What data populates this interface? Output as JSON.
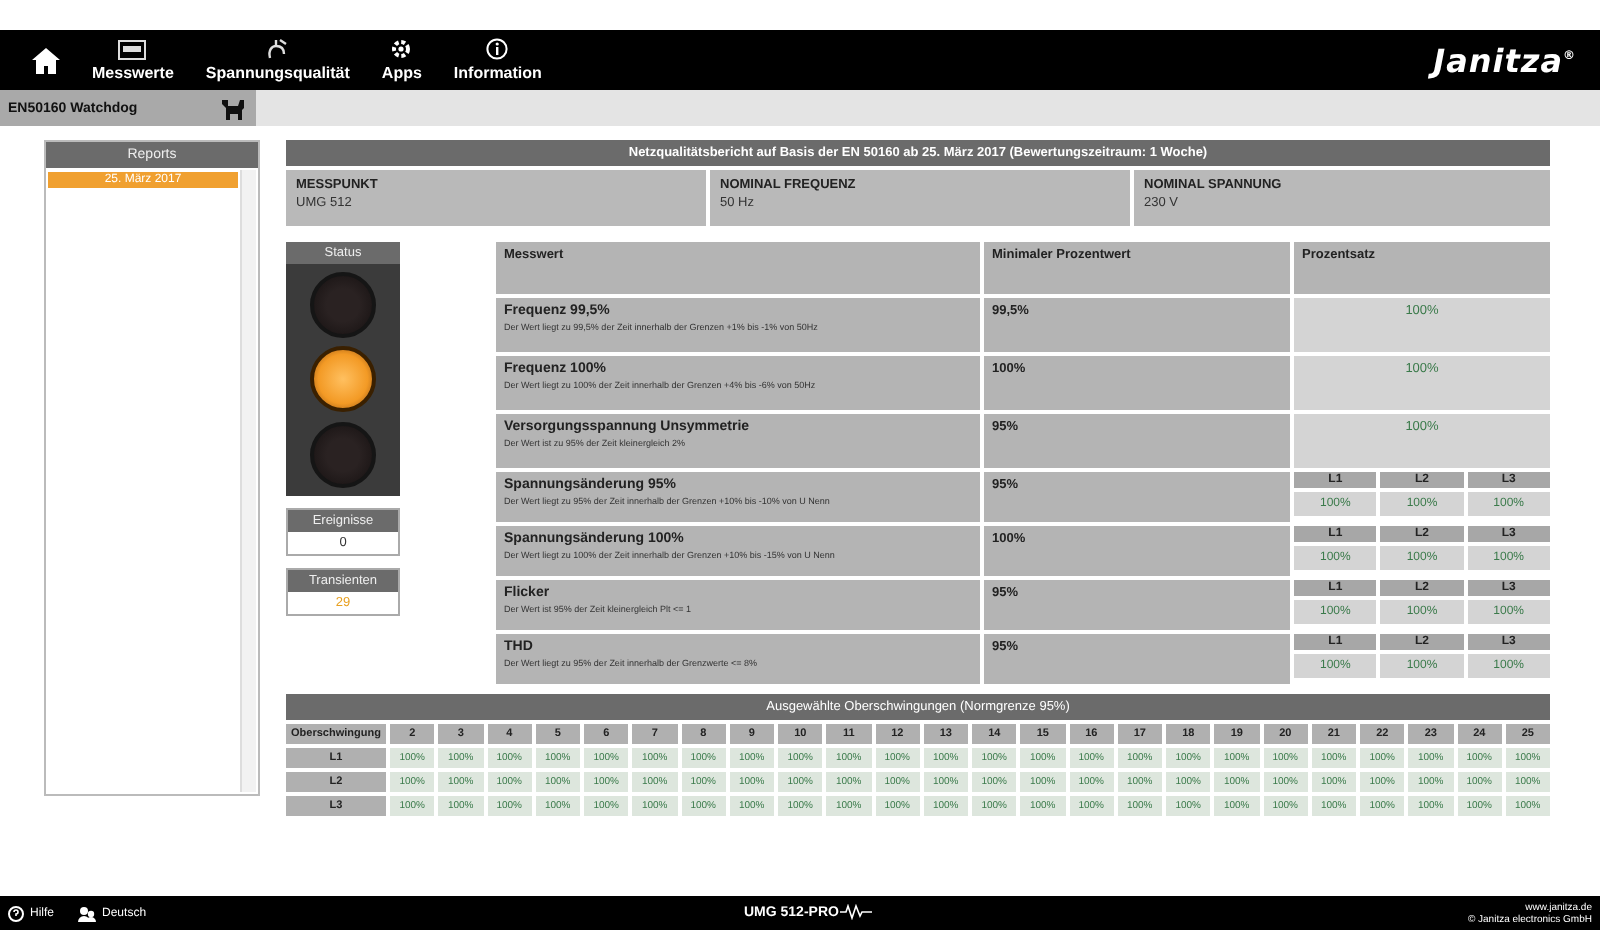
{
  "nav": {
    "items": [
      {
        "kind": "home"
      },
      {
        "kind": "page",
        "label": "Messwerte"
      },
      {
        "kind": "page",
        "label": "Spannungsqualität"
      },
      {
        "kind": "page",
        "label": "Apps"
      },
      {
        "kind": "page",
        "label": "Information"
      }
    ],
    "logo": "Janitza$^{®}$"
  },
  "subbar": {
    "title": "EN50160 Watchdog"
  },
  "reports": {
    "title": "Reports",
    "items": [
      {
        "label": "25. März 2017",
        "selected": true
      }
    ]
  },
  "report": {
    "title": "Netzqualitätsbericht auf Basis der EN 50160 ab 25. März 2017 (Bewertungszeitraum: 1 Woche)",
    "info": [
      {
        "label": "MESSPUNKT",
        "value": "UMG 512"
      },
      {
        "label": "NOMINAL FREQUENZ",
        "value": "50 Hz"
      },
      {
        "label": "NOMINAL SPANNUNG",
        "value": "230 V"
      }
    ],
    "status": {
      "title": "Status",
      "lights": [
        {
          "on": false
        },
        {
          "on": true
        },
        {
          "on": false
        }
      ]
    },
    "counters": [
      {
        "label": "Ereignisse",
        "value": "0",
        "color": "#333333"
      },
      {
        "label": "Transienten",
        "value": "29",
        "color": "#e8a020"
      }
    ],
    "columns": [
      "Messwert",
      "Minimaler Prozentwert",
      "Prozentsatz"
    ],
    "rows": [
      {
        "kind": "single",
        "name": "Frequenz 99,5%",
        "description": "Der Wert liegt zu 99,5% der Zeit innerhalb der Grenzen +1% bis -1% von 50Hz",
        "minimum": "99,5%",
        "percent": "100%"
      },
      {
        "kind": "single",
        "name": "Frequenz 100%",
        "description": "Der Wert liegt zu 100% der Zeit innerhalb der Grenzen +4% bis -6% von 50Hz",
        "minimum": "100%",
        "percent": "100%"
      },
      {
        "kind": "single",
        "name": "Versorgungsspannung Unsymmetrie",
        "description": "Der Wert ist zu 95% der Zeit kleinergleich 2%",
        "minimum": "95%",
        "percent": "100%"
      },
      {
        "kind": "phases",
        "name": "Spannungsänderung 95%",
        "description": "Der Wert liegt zu 95% der Zeit innerhalb der Grenzen +10% bis -10% von U Nenn",
        "minimum": "95%",
        "phases": [
          {
            "label": "L1",
            "value": "100%"
          },
          {
            "label": "L2",
            "value": "100%"
          },
          {
            "label": "L3",
            "value": "100%"
          }
        ]
      },
      {
        "kind": "phases",
        "name": "Spannungsänderung 100%",
        "description": "Der Wert liegt zu 100% der Zeit innerhalb der Grenzen +10% bis -15% von U Nenn",
        "minimum": "100%",
        "phases": [
          {
            "label": "L1",
            "value": "100%"
          },
          {
            "label": "L2",
            "value": "100%"
          },
          {
            "label": "L3",
            "value": "100%"
          }
        ]
      },
      {
        "kind": "phases",
        "name": "Flicker",
        "description": "Der Wert ist 95% der Zeit kleinergleich Plt <= 1",
        "minimum": "95%",
        "phases": [
          {
            "label": "L1",
            "value": "100%"
          },
          {
            "label": "L2",
            "value": "100%"
          },
          {
            "label": "L3",
            "value": "100%"
          }
        ]
      },
      {
        "kind": "phases",
        "name": "THD",
        "description": "Der Wert liegt zu 95% der Zeit innerhalb der Grenzwerte <= 8%",
        "minimum": "95%",
        "phases": [
          {
            "label": "L1",
            "value": "100%"
          },
          {
            "label": "L2",
            "value": "100%"
          },
          {
            "label": "L3",
            "value": "100%"
          }
        ]
      }
    ]
  },
  "harmonics": {
    "title": "Ausgewählte Oberschwingungen (Normgrenze 95%)",
    "header": "Oberschwingung",
    "orders": [
      "2",
      "3",
      "4",
      "5",
      "6",
      "7",
      "8",
      "9",
      "10",
      "11",
      "12",
      "13",
      "14",
      "15",
      "16",
      "17",
      "18",
      "19",
      "20",
      "21",
      "22",
      "23",
      "24",
      "25"
    ],
    "rows": [
      {
        "label": "L1",
        "values": [
          "100%",
          "100%",
          "100%",
          "100%",
          "100%",
          "100%",
          "100%",
          "100%",
          "100%",
          "100%",
          "100%",
          "100%",
          "100%",
          "100%",
          "100%",
          "100%",
          "100%",
          "100%",
          "100%",
          "100%",
          "100%",
          "100%",
          "100%",
          "100%"
        ]
      },
      {
        "label": "L2",
        "values": [
          "100%",
          "100%",
          "100%",
          "100%",
          "100%",
          "100%",
          "100%",
          "100%",
          "100%",
          "100%",
          "100%",
          "100%",
          "100%",
          "100%",
          "100%",
          "100%",
          "100%",
          "100%",
          "100%",
          "100%",
          "100%",
          "100%",
          "100%",
          "100%"
        ]
      },
      {
        "label": "L3",
        "values": [
          "100%",
          "100%",
          "100%",
          "100%",
          "100%",
          "100%",
          "100%",
          "100%",
          "100%",
          "100%",
          "100%",
          "100%",
          "100%",
          "100%",
          "100%",
          "100%",
          "100%",
          "100%",
          "100%",
          "100%",
          "100%",
          "100%",
          "100%",
          "100%"
        ]
      }
    ]
  },
  "footer": {
    "help": "Hilfe",
    "language": "Deutsch",
    "device": "UMG 512-PRO",
    "website": "www.janitza.de",
    "copyright": "© Janitza electronics GmbH"
  }
}
